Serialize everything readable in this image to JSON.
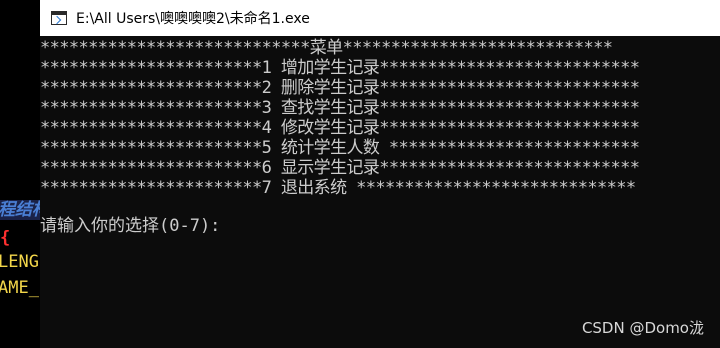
{
  "window": {
    "title": "E:\\All Users\\噢噢噢噢2\\未命名1.exe",
    "icon": "console-app-icon"
  },
  "background_editor": {
    "fragments": [
      "程结构",
      "{",
      "LENG",
      "AME_"
    ]
  },
  "console": {
    "menu_lines": [
      "****************************菜单****************************",
      "***********************1 增加学生记录***************************",
      "***********************2 删除学生记录***************************",
      "***********************3 查找学生记录***************************",
      "***********************4 修改学生记录***************************",
      "***********************5 统计学生人数 **************************",
      "***********************6 显示学生记录***************************",
      "***********************7 退出系统 *****************************"
    ],
    "prompt": "请输入你的选择(0-7):"
  },
  "watermark": "CSDN @Domo泷"
}
